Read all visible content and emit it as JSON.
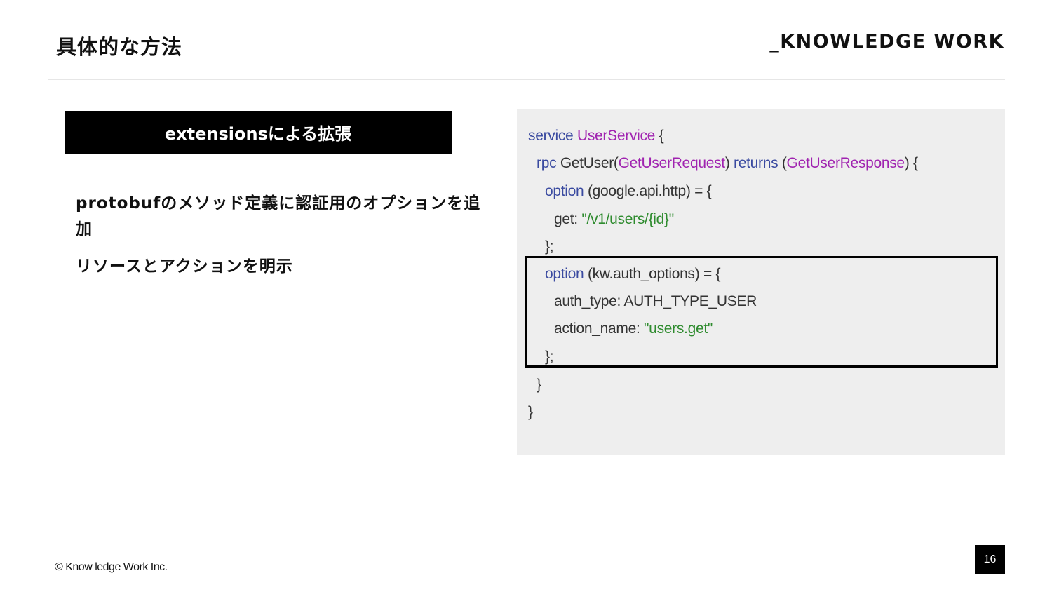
{
  "slide": {
    "title": "具体的な方法",
    "logo": "_KNOWLEDGE WORK",
    "copyright": "© Know ledge Work Inc.",
    "page_number": "16"
  },
  "left": {
    "heading": "extensionsによる拡張",
    "points": [
      "protobufのメソッド定義に認証用のオプションを追加",
      "リソースとアクションを明示"
    ]
  },
  "code": {
    "line1": {
      "kw": "service",
      "name": "UserService",
      "brace": " {"
    },
    "line2": {
      "kw": "rpc",
      "method": " GetUser(",
      "req": "GetUserRequest",
      "mid": ") ",
      "returns": "returns",
      "open": " (",
      "res": "GetUserResponse",
      "close": ") {"
    },
    "line3": {
      "kw": "option",
      "rest": " (google.api.http) = {"
    },
    "line4": {
      "key": "get: ",
      "value": "\"/v1/users/{id}\""
    },
    "line5": "};",
    "line6": {
      "kw": "option",
      "rest": " (kw.auth_options) = {"
    },
    "line7": "auth_type: AUTH_TYPE_USER",
    "line8": {
      "key": "action_name: ",
      "value": "\"users.get\""
    },
    "line9": "};",
    "line10": "}",
    "line11": "}"
  },
  "colors": {
    "keyword": "#3a4aa0",
    "type": "#a023b0",
    "string": "#2e8b2e",
    "code_background": "#eeeeee"
  }
}
